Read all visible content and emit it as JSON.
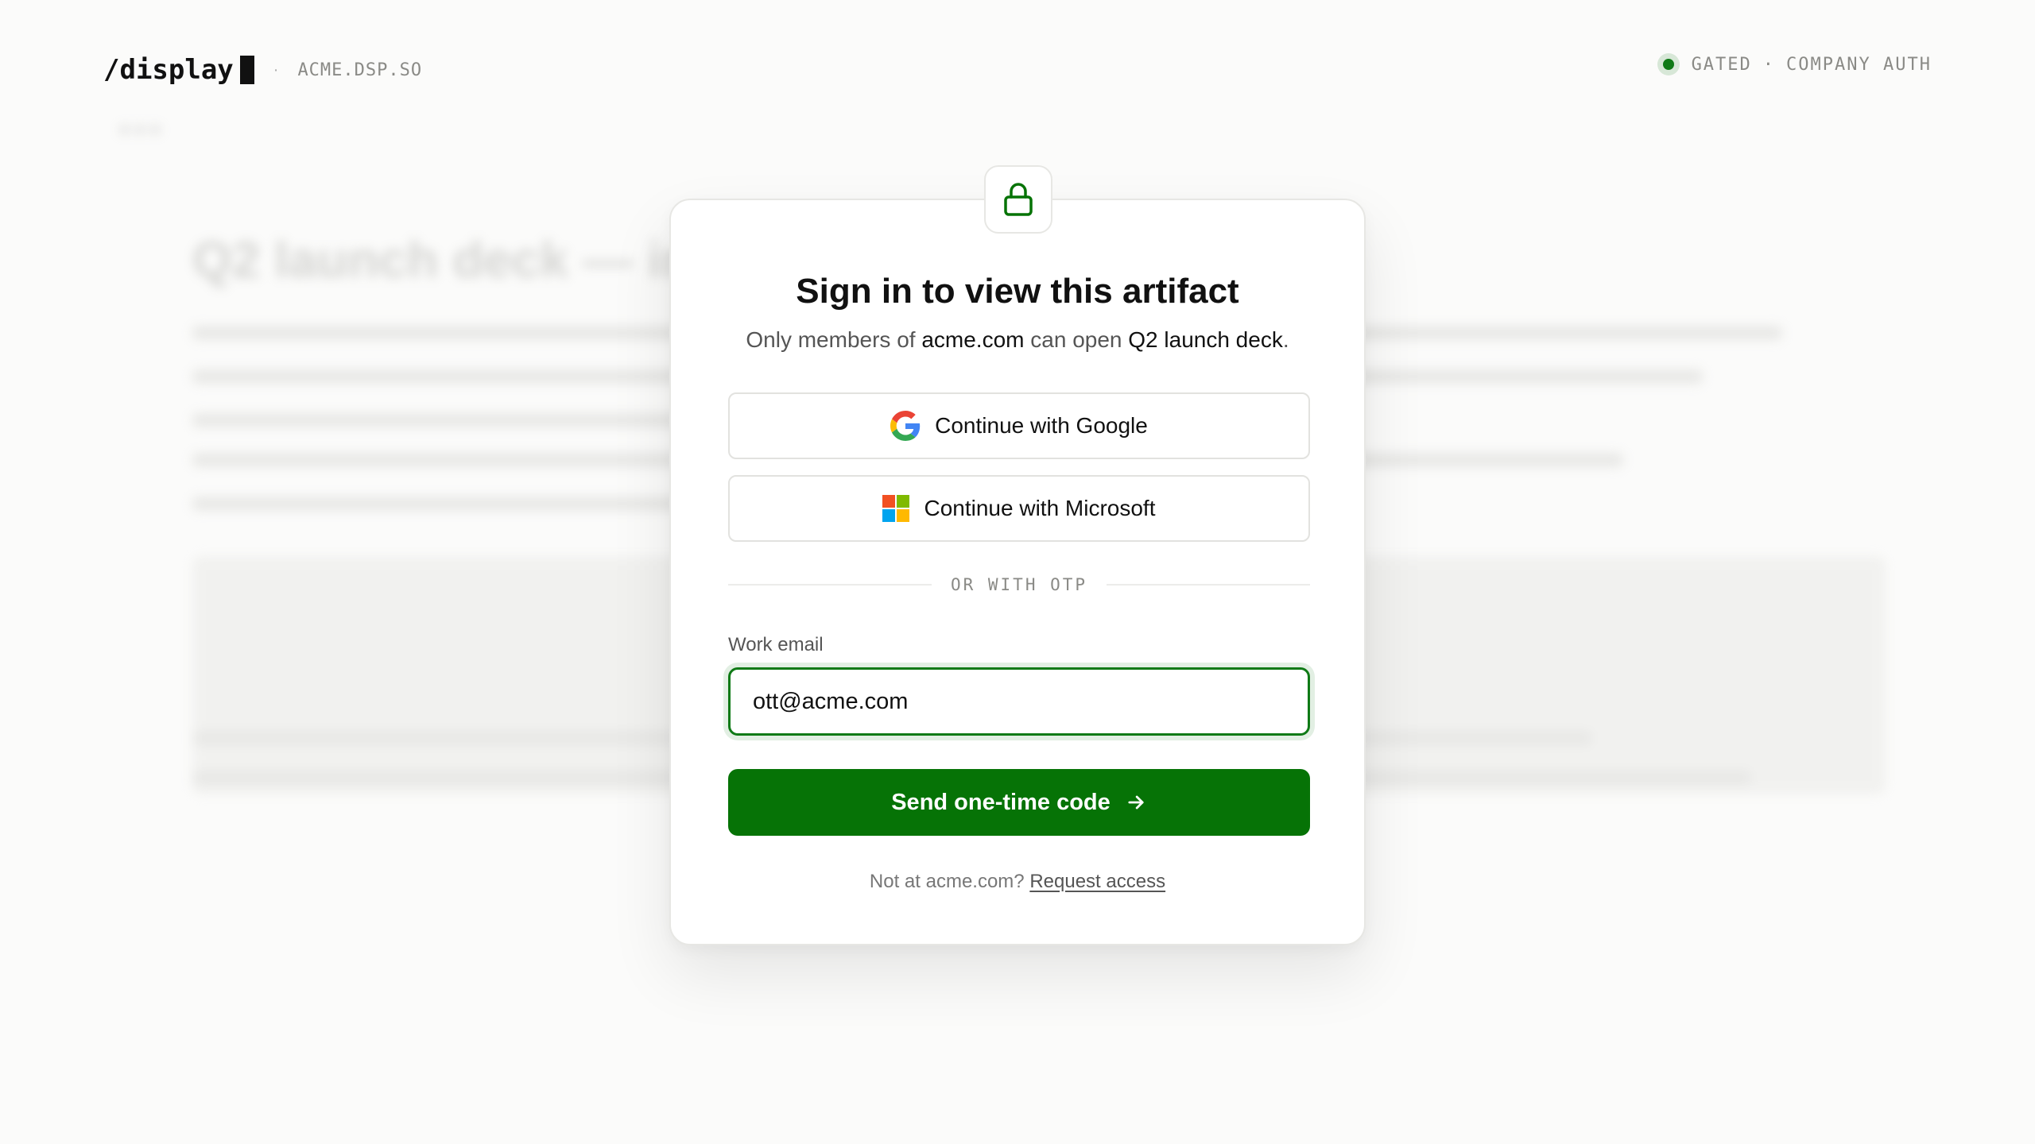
{
  "header": {
    "logo": "/display",
    "separator": "·",
    "domain": "ACME.DSP.SO",
    "status_label": "GATED",
    "status_separator": "·",
    "status_mode": "COMPANY AUTH",
    "status_color": "#0f7a16"
  },
  "background_document": {
    "title": "Q2 launch deck — in"
  },
  "modal": {
    "icon": "lock-icon",
    "title": "Sign in to view this artifact",
    "subtitle_prefix": "Only members of",
    "subtitle_domain": "acme.com",
    "subtitle_middle": "can open",
    "subtitle_artifact": "Q2 launch deck",
    "subtitle_suffix": ".",
    "google_button": {
      "label": "Continue with Google",
      "icon": "google-icon"
    },
    "microsoft_button": {
      "label": "Continue with Microsoft",
      "icon": "microsoft-icon"
    },
    "divider_label": "OR WITH OTP",
    "email_label": "Work email",
    "email_value": "ott@acme.com",
    "submit_label": "Send one-time code",
    "submit_icon": "arrow-right-icon",
    "footer_prefix": "Not at acme.com?",
    "footer_link": "Request access",
    "accent_color": "#067306"
  }
}
